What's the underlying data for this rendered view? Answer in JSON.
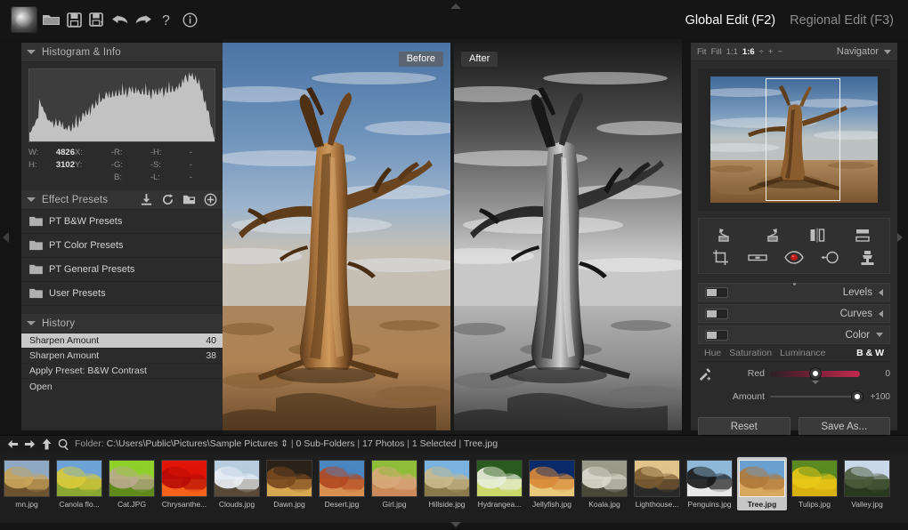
{
  "app": {
    "logo_icon": "app-logo-icon"
  },
  "toolbar": {
    "icons": [
      {
        "name": "open-folder-icon",
        "title": "Open"
      },
      {
        "name": "save-icon",
        "title": "Save"
      },
      {
        "name": "save-as-icon",
        "title": "Save As"
      },
      {
        "name": "undo-icon",
        "title": "Undo"
      },
      {
        "name": "redo-icon",
        "title": "Redo"
      },
      {
        "name": "help-icon",
        "title": "Help"
      },
      {
        "name": "info-icon",
        "title": "Info"
      }
    ]
  },
  "edit_tabs": [
    {
      "label": "Global Edit (F2)",
      "active": true
    },
    {
      "label": "Regional Edit (F3)",
      "active": false
    }
  ],
  "left_panel": {
    "histogram": {
      "title": "Histogram & Info",
      "info": {
        "w_key": "W:",
        "w_value": "4826",
        "h_key": "H:",
        "h_value": "3102",
        "x_key": "X:",
        "x_value": "-",
        "y_key": "Y:",
        "y_value": "-",
        "r_key": "R:",
        "r_value": "-",
        "g_key": "G:",
        "g_value": "-",
        "b_key": "B:",
        "b_value": "-",
        "hu_key": "H:",
        "hu_value": "-",
        "s_key": "S:",
        "s_value": "-",
        "l_key": "L:",
        "l_value": "-"
      }
    },
    "effect_presets": {
      "title": "Effect Presets",
      "header_icons": [
        {
          "name": "import-preset-icon"
        },
        {
          "name": "refresh-presets-icon"
        },
        {
          "name": "new-preset-folder-icon"
        },
        {
          "name": "add-preset-icon"
        }
      ],
      "items": [
        {
          "label": "PT B&W Presets"
        },
        {
          "label": "PT Color Presets"
        },
        {
          "label": "PT General Presets"
        },
        {
          "label": "User Presets"
        }
      ]
    },
    "history": {
      "title": "History",
      "items": [
        {
          "label": "Sharpen Amount",
          "value": "40",
          "selected": true
        },
        {
          "label": "Sharpen Amount",
          "value": "38",
          "selected": false
        },
        {
          "label": "Apply Preset: B&W Contrast",
          "value": "",
          "selected": false
        },
        {
          "label": "Open",
          "value": "",
          "selected": false
        }
      ]
    }
  },
  "canvas": {
    "before_label": "Before",
    "after_label": "After"
  },
  "right_panel": {
    "navigator": {
      "title": "Navigator",
      "zoom_fit": "Fit",
      "zoom_fill": "Fill",
      "zoom_1to1": "1:1",
      "zoom_current": "1:6",
      "zoom_ratio_icon": "ratio-divider-icon",
      "zoom_in": "+",
      "zoom_out": "−"
    },
    "tools": [
      {
        "name": "rotate-left-icon"
      },
      {
        "name": "rotate-right-icon"
      },
      {
        "name": "flip-horizontal-icon"
      },
      {
        "name": "flip-vertical-icon"
      },
      {
        "name": "crop-icon"
      },
      {
        "name": "straighten-icon"
      },
      {
        "name": "red-eye-icon"
      },
      {
        "name": "spot-heal-icon"
      },
      {
        "name": "clone-stamp-icon"
      }
    ],
    "adjustments": [
      {
        "name": "Levels",
        "expanded": false,
        "enabled": false
      },
      {
        "name": "Curves",
        "expanded": false,
        "enabled": false
      },
      {
        "name": "Color",
        "expanded": true,
        "enabled": false
      }
    ],
    "color_subtabs": [
      {
        "label": "Hue",
        "active": false
      },
      {
        "label": "Saturation",
        "active": false
      },
      {
        "label": "Luminance",
        "active": false
      }
    ],
    "bw_tab": {
      "label": "B & W",
      "active": true
    },
    "sliders": [
      {
        "label": "Red",
        "value": "0",
        "percent": 50,
        "style": "red",
        "has_eyedropper": true
      },
      {
        "label": "Amount",
        "value": "+100",
        "percent": 97,
        "style": "plain",
        "has_eyedropper": false
      }
    ],
    "buttons": [
      {
        "label": "Reset",
        "name": "reset-button"
      },
      {
        "label": "Save As...",
        "name": "save-as-button"
      }
    ]
  },
  "statusbar": {
    "icons": [
      {
        "name": "nav-back-icon"
      },
      {
        "name": "nav-forward-icon"
      },
      {
        "name": "nav-up-icon"
      },
      {
        "name": "search-icon"
      }
    ],
    "folder_label": "Folder:",
    "path": "C:\\Users\\Public\\Pictures\\Sample Pictures",
    "path_sort_icon": "sort-toggle-icon",
    "subfolders": "0 Sub-Folders",
    "photos": "17 Photos",
    "selected": "1 Selected",
    "current_file": "Tree.jpg",
    "separator": "|"
  },
  "filmstrip": {
    "items": [
      {
        "name": "mn.jpg",
        "selected": false,
        "palette": [
          "#8fa9c4",
          "#c9a45a",
          "#6d5330"
        ]
      },
      {
        "name": "Canola flo...",
        "selected": false,
        "palette": [
          "#6ea3d8",
          "#d8c93a",
          "#8aa832"
        ]
      },
      {
        "name": "Cat.JPG",
        "selected": false,
        "palette": [
          "#8fd02a",
          "#b9a98c",
          "#5f8a1c"
        ]
      },
      {
        "name": "Chrysanthe...",
        "selected": false,
        "palette": [
          "#e01507",
          "#b80c05",
          "#f5621a"
        ]
      },
      {
        "name": "Clouds.jpg",
        "selected": false,
        "palette": [
          "#b9cde0",
          "#e8eef4",
          "#5a4a38"
        ]
      },
      {
        "name": "Dawn.jpg",
        "selected": false,
        "palette": [
          "#2a2218",
          "#7a4a20",
          "#d8a850"
        ]
      },
      {
        "name": "Desert.jpg",
        "selected": false,
        "palette": [
          "#4a86c0",
          "#b34a22",
          "#d89050"
        ]
      },
      {
        "name": "Girl.jpg",
        "selected": false,
        "palette": [
          "#8fbd3a",
          "#d8a87a",
          "#c98a5a"
        ]
      },
      {
        "name": "Hillside.jpg",
        "selected": false,
        "palette": [
          "#7ab3e0",
          "#c9b88a",
          "#8a7a4a"
        ]
      },
      {
        "name": "Hydrangea...",
        "selected": false,
        "palette": [
          "#2a5a20",
          "#e8eed8",
          "#c9d86a"
        ]
      },
      {
        "name": "Jellyfish.jpg",
        "selected": false,
        "palette": [
          "#0a2a6a",
          "#d88a3a",
          "#e8c87a"
        ]
      },
      {
        "name": "Koala.jpg",
        "selected": false,
        "palette": [
          "#9a9a8a",
          "#d8d8cc",
          "#4a4a3a"
        ]
      },
      {
        "name": "Lighthouse...",
        "selected": false,
        "palette": [
          "#e0c48a",
          "#7a5a30",
          "#2a2a2a"
        ]
      },
      {
        "name": "Penguins.jpg",
        "selected": false,
        "palette": [
          "#8fb8d8",
          "#1a1a1a",
          "#e8e8e8"
        ]
      },
      {
        "name": "Tree.jpg",
        "selected": true,
        "palette": [
          "#6a9fd0",
          "#b07a3a",
          "#d8a860"
        ]
      },
      {
        "name": "Tulips.jpg",
        "selected": false,
        "palette": [
          "#5a8a20",
          "#e8c818",
          "#d8b010"
        ]
      },
      {
        "name": "Valley.jpg",
        "selected": false,
        "palette": [
          "#c9d8e8",
          "#4a5a3a",
          "#2a3a20"
        ]
      }
    ]
  }
}
